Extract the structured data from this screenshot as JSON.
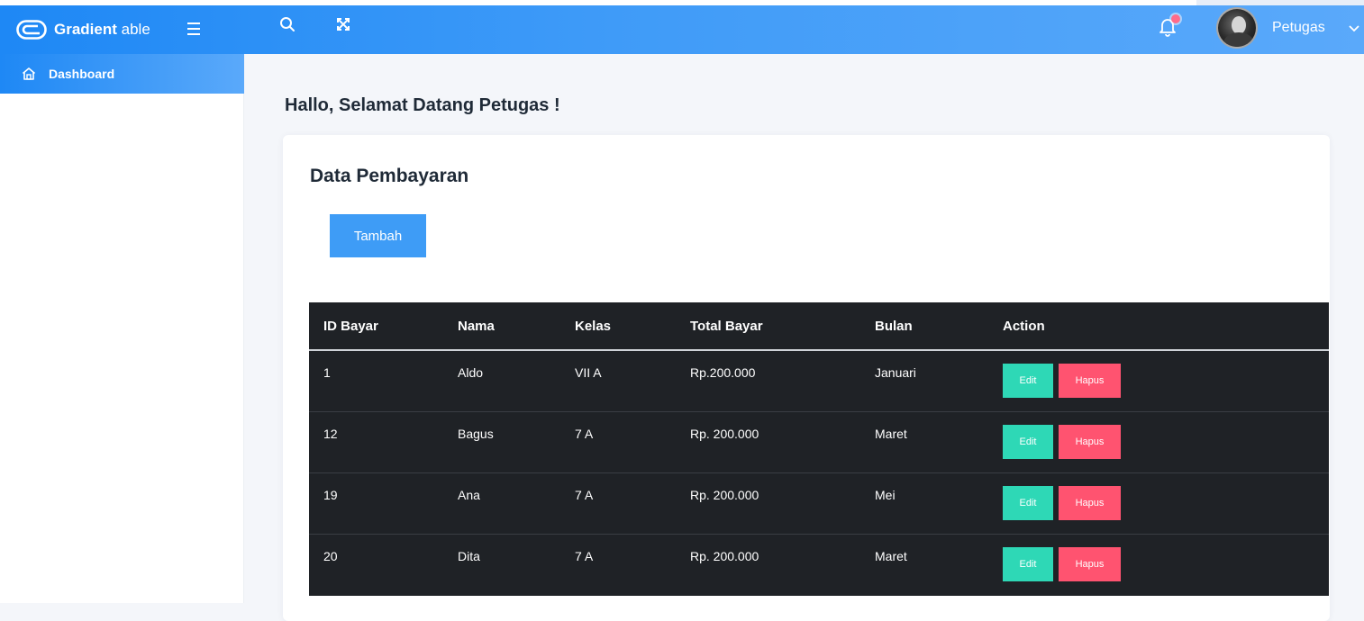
{
  "brand": {
    "name_bold": "Gradient",
    "name_light": " able"
  },
  "header": {
    "user_name": "Petugas"
  },
  "sidebar": {
    "items": [
      {
        "label": "Dashboard",
        "active": true
      }
    ]
  },
  "page": {
    "greeting": "Hallo, Selamat Datang Petugas !"
  },
  "card": {
    "title": "Data Pembayaran",
    "add_button_label": "Tambah"
  },
  "table": {
    "columns": [
      "ID Bayar",
      "Nama",
      "Kelas",
      "Total Bayar",
      "Bulan",
      "Action"
    ],
    "rows": [
      {
        "id": "1",
        "nama": "Aldo",
        "kelas": "VII A",
        "total": "Rp.200.000",
        "bulan": "Januari"
      },
      {
        "id": "12",
        "nama": "Bagus",
        "kelas": "7 A",
        "total": "Rp. 200.000",
        "bulan": "Maret"
      },
      {
        "id": "19",
        "nama": "Ana",
        "kelas": "7 A",
        "total": "Rp. 200.000",
        "bulan": "Mei"
      },
      {
        "id": "20",
        "nama": "Dita",
        "kelas": "7 A",
        "total": "Rp. 200.000",
        "bulan": "Maret"
      }
    ],
    "edit_label": "Edit",
    "delete_label": "Hapus"
  },
  "colors": {
    "header_start": "#1e88f5",
    "header_end": "#5aa9fa",
    "table_bg": "#1f2226",
    "edit_button": "#2ed8b6",
    "delete_button": "#ff5370",
    "primary_button": "#3e9cf6"
  },
  "icons": {
    "logo": "gradient-able-logo-icon",
    "menu": "hamburger-icon",
    "search": "search-icon",
    "fullscreen": "fullscreen-icon",
    "notification": "bell-icon",
    "user_menu": "chevron-down-icon",
    "dashboard": "home-icon"
  }
}
